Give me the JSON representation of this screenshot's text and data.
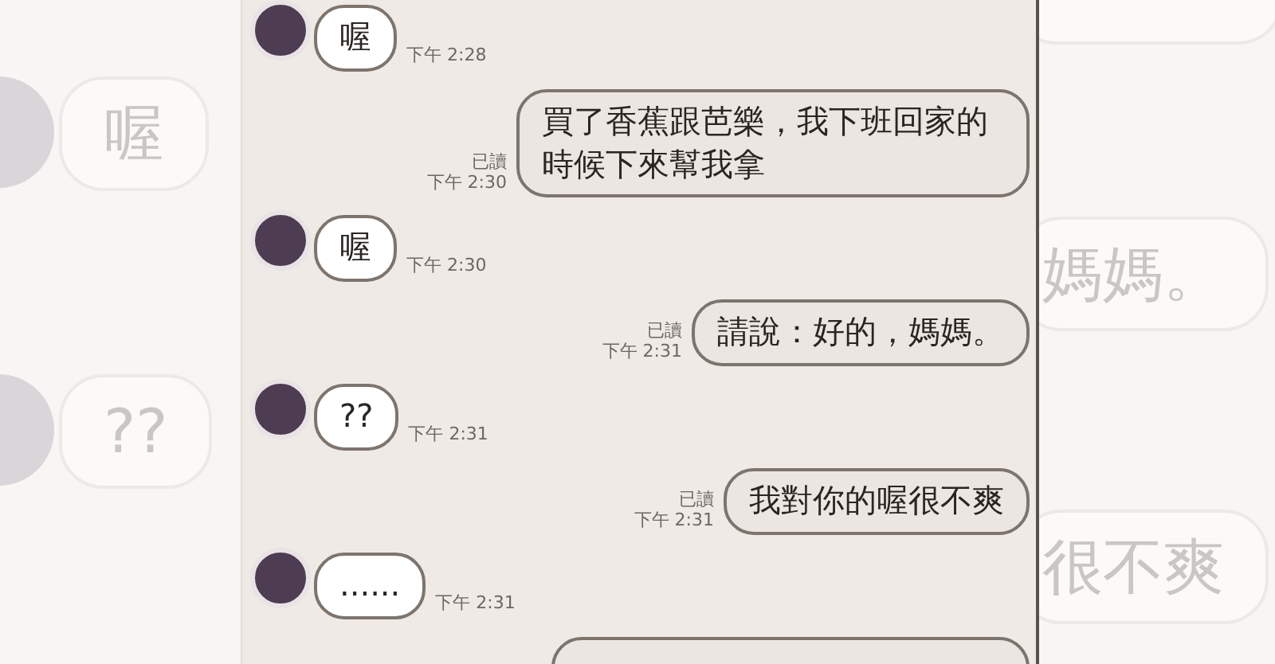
{
  "backdrop_left": {
    "messages": [
      {
        "text": "喔"
      },
      {
        "text": "??"
      }
    ]
  },
  "chat": {
    "messages": [
      {
        "kind": "incoming",
        "text": "喔",
        "time": "下午 2:28"
      },
      {
        "kind": "outgoing",
        "text": "買了香蕉跟芭樂，我下班回家的時候下來幫我拿",
        "time": "下午 2:30",
        "read_label": "已讀"
      },
      {
        "kind": "incoming",
        "text": "喔",
        "time": "下午 2:30"
      },
      {
        "kind": "outgoing",
        "text": "請說：好的，媽媽。",
        "time": "下午 2:31",
        "read_label": "已讀"
      },
      {
        "kind": "incoming",
        "text": "??",
        "time": "下午 2:31"
      },
      {
        "kind": "outgoing",
        "text": "我對你的喔很不爽",
        "time": "下午 2:31",
        "read_label": "已讀"
      },
      {
        "kind": "incoming",
        "text": "......",
        "time": "下午 2:31"
      },
      {
        "kind": "outgoing"
      }
    ]
  },
  "backdrop_right": {
    "messages": [
      {
        "text": "媽媽。"
      },
      {
        "text": "很不爽"
      }
    ]
  }
}
